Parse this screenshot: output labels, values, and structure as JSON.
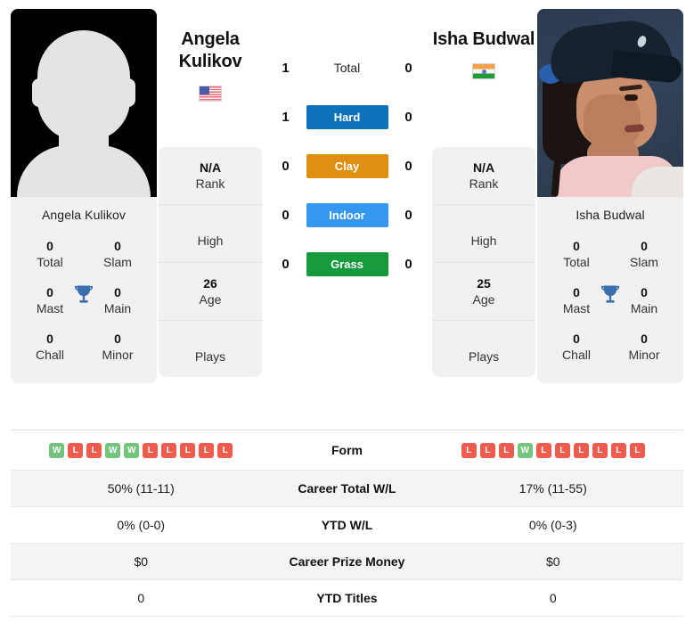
{
  "colors": {
    "hard": "#0d72ba",
    "clay": "#e09010",
    "indoor": "#3498f0",
    "grass": "#159b3c",
    "win": "#74c47e",
    "loss": "#ef5b4c",
    "trophy": "#3a6fad"
  },
  "player_left": {
    "name": "Angela Kulikov",
    "name_line1": "Angela",
    "name_line2": "Kulikov",
    "flag": "us-flag-icon",
    "photo": "placeholder-avatar",
    "card_name": "Angela Kulikov",
    "titles": [
      {
        "value": "0",
        "label": "Total"
      },
      {
        "value": "0",
        "label": "Slam"
      },
      {
        "value": "0",
        "label": "Mast"
      },
      {
        "value": "0",
        "label": "Main"
      },
      {
        "value": "0",
        "label": "Chall"
      },
      {
        "value": "0",
        "label": "Minor"
      }
    ],
    "info": [
      {
        "value": "N/A",
        "label": "Rank"
      },
      {
        "value": "",
        "label": "High"
      },
      {
        "value": "26",
        "label": "Age"
      },
      {
        "value": "",
        "label": "Plays"
      }
    ],
    "form": [
      "W",
      "L",
      "L",
      "W",
      "W",
      "L",
      "L",
      "L",
      "L",
      "L"
    ],
    "career_total_wl": "50% (11-11)",
    "ytd_wl": "0% (0-0)",
    "career_prize_money": "$0",
    "ytd_titles": "0"
  },
  "player_right": {
    "name": "Isha Budwal",
    "name_line1": "Isha Budwal",
    "name_line2": "",
    "flag": "india-flag-icon",
    "photo": "player-photo",
    "card_name": "Isha Budwal",
    "titles": [
      {
        "value": "0",
        "label": "Total"
      },
      {
        "value": "0",
        "label": "Slam"
      },
      {
        "value": "0",
        "label": "Mast"
      },
      {
        "value": "0",
        "label": "Main"
      },
      {
        "value": "0",
        "label": "Chall"
      },
      {
        "value": "0",
        "label": "Minor"
      }
    ],
    "info": [
      {
        "value": "N/A",
        "label": "Rank"
      },
      {
        "value": "",
        "label": "High"
      },
      {
        "value": "25",
        "label": "Age"
      },
      {
        "value": "",
        "label": "Plays"
      }
    ],
    "form": [
      "L",
      "L",
      "L",
      "W",
      "L",
      "L",
      "L",
      "L",
      "L",
      "L"
    ],
    "career_total_wl": "17% (11-55)",
    "ytd_wl": "0% (0-3)",
    "career_prize_money": "$0",
    "ytd_titles": "0"
  },
  "head_to_head": [
    {
      "label": "Total",
      "left": "1",
      "right": "0",
      "surface": "total"
    },
    {
      "label": "Hard",
      "left": "1",
      "right": "0",
      "surface": "hard"
    },
    {
      "label": "Clay",
      "left": "0",
      "right": "0",
      "surface": "clay"
    },
    {
      "label": "Indoor",
      "left": "0",
      "right": "0",
      "surface": "indoor"
    },
    {
      "label": "Grass",
      "left": "0",
      "right": "0",
      "surface": "grass"
    }
  ],
  "stats_rows": [
    {
      "label": "Form",
      "left": "",
      "right": ""
    },
    {
      "label": "Career Total W/L",
      "left": "50% (11-11)",
      "right": "17% (11-55)"
    },
    {
      "label": "YTD W/L",
      "left": "0% (0-0)",
      "right": "0% (0-3)"
    },
    {
      "label": "Career Prize Money",
      "left": "$0",
      "right": "$0"
    },
    {
      "label": "YTD Titles",
      "left": "0",
      "right": "0"
    }
  ]
}
